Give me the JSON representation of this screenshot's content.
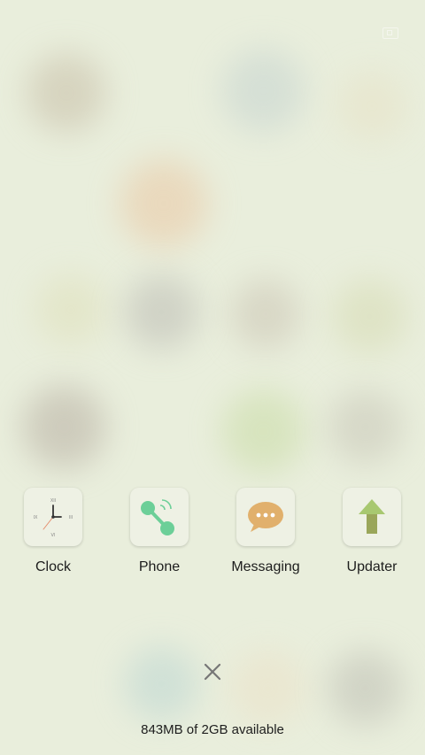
{
  "background": {
    "color": "#e9eedc",
    "blobs": [
      {
        "color": "#c8bfa8"
      },
      {
        "color": "#c6d4d0"
      },
      {
        "color": "#e7e2c6"
      },
      {
        "color": "#eac8a4"
      },
      {
        "color": "#dfe0bb"
      },
      {
        "color": "#bcbcb4"
      },
      {
        "color": "#cbc5b4"
      },
      {
        "color": "#d6dbb3"
      },
      {
        "color": "#b8b0a3"
      },
      {
        "color": "#c9dca6"
      },
      {
        "color": "#c8c7b8"
      },
      {
        "color": "#bcd6d2"
      },
      {
        "color": "#ebe1c7"
      },
      {
        "color": "#bebfb4"
      }
    ]
  },
  "dock": {
    "apps": [
      {
        "label": "Clock",
        "icon": "clock-icon"
      },
      {
        "label": "Phone",
        "icon": "phone-icon"
      },
      {
        "label": "Messaging",
        "icon": "messaging-icon"
      },
      {
        "label": "Updater",
        "icon": "updater-icon"
      }
    ]
  },
  "close_icon": "close-icon",
  "memory_text": "843MB of 2GB available",
  "colors": {
    "phone_green": "#6ccf98",
    "message_orange": "#e1b06c",
    "updater_green": "#a8c870",
    "updater_olive": "#9aa65a"
  }
}
